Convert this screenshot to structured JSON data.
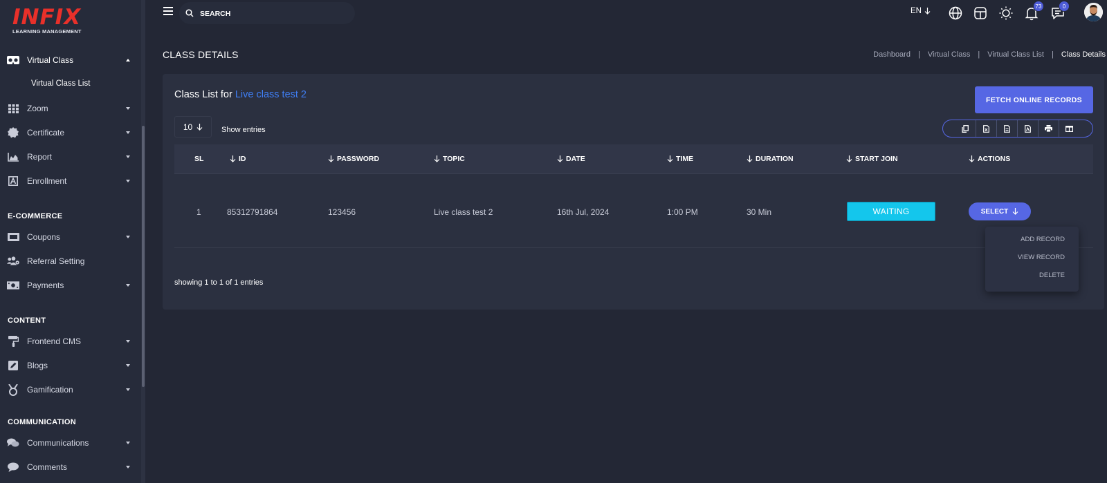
{
  "logo": {
    "mark": "INFIX",
    "subtitle": "LEARNING MANAGEMENT"
  },
  "sidebar": {
    "virtual_class": {
      "label": "Virtual Class",
      "icon": "vr-goggles-icon",
      "sub_item": "Virtual Class List"
    },
    "items_top": [
      {
        "label": "Zoom",
        "icon": "grid-icon"
      },
      {
        "label": "Certificate",
        "icon": "certificate-badge-icon"
      },
      {
        "label": "Report",
        "icon": "area-chart-icon"
      },
      {
        "label": "Enrollment",
        "icon": "enrollment-icon"
      }
    ],
    "ecommerce": {
      "title": "E-COMMERCE",
      "items": [
        {
          "label": "Coupons",
          "icon": "ticket-icon"
        },
        {
          "label": "Referral Setting",
          "icon": "users-gear-icon"
        },
        {
          "label": "Payments",
          "icon": "money-bill-icon"
        }
      ]
    },
    "content": {
      "title": "CONTENT",
      "items": [
        {
          "label": "Frontend CMS",
          "icon": "paint-roller-icon"
        },
        {
          "label": "Blogs",
          "icon": "pen-square-icon"
        },
        {
          "label": "Gamification",
          "icon": "medal-icon"
        }
      ]
    },
    "communication": {
      "title": "COMMUNICATION",
      "items": [
        {
          "label": "Communications",
          "icon": "chat-bubbles-icon"
        },
        {
          "label": "Comments",
          "icon": "comment-icon"
        }
      ]
    }
  },
  "topbar": {
    "search_label": "SEARCH",
    "language": "EN",
    "notifications_count": "73",
    "messages_count": "0"
  },
  "page": {
    "title": "CLASS DETAILS",
    "breadcrumb": [
      "Dashboard",
      "Virtual Class",
      "Virtual Class List"
    ],
    "breadcrumb_current": "Class Details"
  },
  "card": {
    "title_prefix": "Class List for",
    "title_class": "Live class test 2",
    "fetch_button": "FETCH ONLINE RECORDS",
    "entries_value": "10",
    "entries_label": "Show entries",
    "export_buttons": [
      "copy-icon",
      "excel-icon",
      "csv-icon",
      "pdf-icon",
      "print-icon",
      "columns-icon"
    ]
  },
  "table": {
    "headers": [
      "SL",
      "ID",
      "PASSWORD",
      "TOPIC",
      "DATE",
      "TIME",
      "DURATION",
      "START JOIN",
      "ACTIONS"
    ],
    "rows": [
      {
        "sl": "1",
        "id": "85312791864",
        "password": "123456",
        "topic": "Live class test 2",
        "date": "16th Jul, 2024",
        "time": "1:00 PM",
        "duration": "30 Min",
        "start_join": "WAITING",
        "action": "SELECT"
      }
    ],
    "showing": "showing 1 to 1 of 1 entries"
  },
  "dropdown": {
    "items": [
      "ADD RECORD",
      "VIEW RECORD",
      "DELETE"
    ]
  },
  "colors": {
    "accent": "#5667e4",
    "link": "#3f7ef4",
    "waiting": "#14c6ec",
    "brand": "#e8302a"
  }
}
